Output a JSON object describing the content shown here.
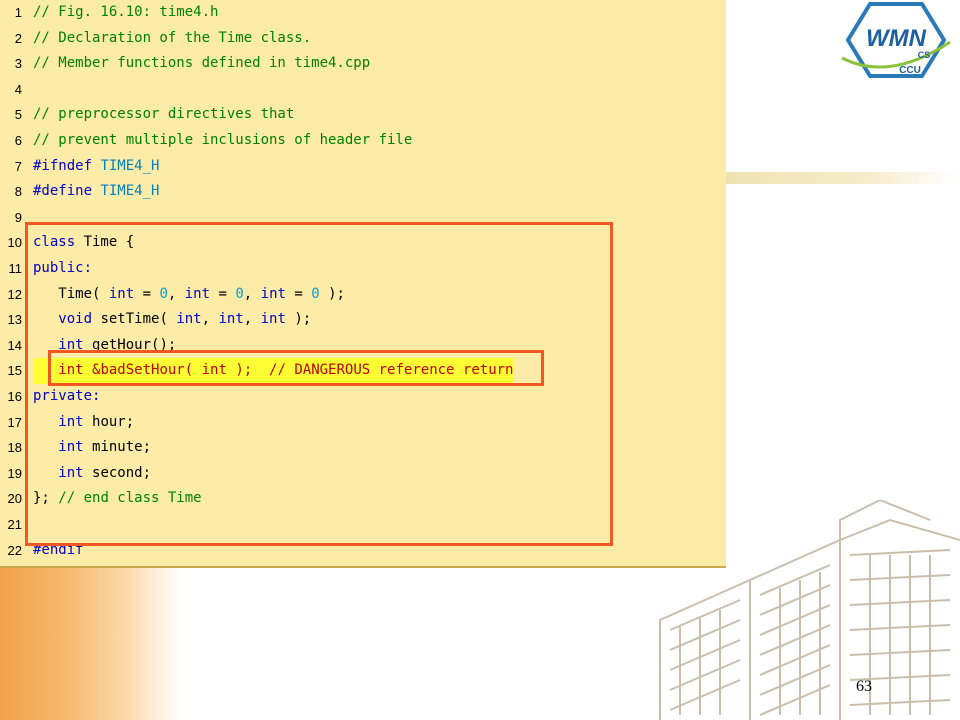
{
  "slide": {
    "page_number": "63",
    "logo": {
      "text_main": "WMN",
      "text_sub": "CS",
      "text_bottom": "CCU"
    }
  },
  "code": {
    "lines": [
      {
        "n": "1",
        "tokens": [
          {
            "t": "// Fig. 16.10: time4.h",
            "c": "cm"
          }
        ]
      },
      {
        "n": "2",
        "tokens": [
          {
            "t": "// Declaration of the Time class.",
            "c": "cm"
          }
        ]
      },
      {
        "n": "3",
        "tokens": [
          {
            "t": "// Member functions defined in time4.cpp",
            "c": "cm"
          }
        ]
      },
      {
        "n": "4",
        "tokens": []
      },
      {
        "n": "5",
        "tokens": [
          {
            "t": "// preprocessor directives that",
            "c": "cm"
          }
        ]
      },
      {
        "n": "6",
        "tokens": [
          {
            "t": "// prevent multiple inclusions of header file",
            "c": "cm"
          }
        ]
      },
      {
        "n": "7",
        "tokens": [
          {
            "t": "#ifndef ",
            "c": "pp"
          },
          {
            "t": "TIME4_H",
            "c": "nm"
          }
        ]
      },
      {
        "n": "8",
        "tokens": [
          {
            "t": "#define ",
            "c": "pp"
          },
          {
            "t": "TIME4_H",
            "c": "nm"
          }
        ]
      },
      {
        "n": "9",
        "tokens": []
      },
      {
        "n": "10",
        "tokens": [
          {
            "t": "class ",
            "c": "kw"
          },
          {
            "t": "Time {",
            "c": "id"
          }
        ]
      },
      {
        "n": "11",
        "tokens": [
          {
            "t": "public:",
            "c": "kw"
          }
        ]
      },
      {
        "n": "12",
        "tokens": [
          {
            "t": "   Time( ",
            "c": "id"
          },
          {
            "t": "int",
            "c": "kw"
          },
          {
            "t": " = ",
            "c": "id"
          },
          {
            "t": "0",
            "c": "num"
          },
          {
            "t": ", ",
            "c": "id"
          },
          {
            "t": "int",
            "c": "kw"
          },
          {
            "t": " = ",
            "c": "id"
          },
          {
            "t": "0",
            "c": "num"
          },
          {
            "t": ", ",
            "c": "id"
          },
          {
            "t": "int",
            "c": "kw"
          },
          {
            "t": " = ",
            "c": "id"
          },
          {
            "t": "0",
            "c": "num"
          },
          {
            "t": " );",
            "c": "id"
          }
        ]
      },
      {
        "n": "13",
        "tokens": [
          {
            "t": "   ",
            "c": "id"
          },
          {
            "t": "void",
            "c": "kw"
          },
          {
            "t": " setTime( ",
            "c": "id"
          },
          {
            "t": "int",
            "c": "kw"
          },
          {
            "t": ", ",
            "c": "id"
          },
          {
            "t": "int",
            "c": "kw"
          },
          {
            "t": ", ",
            "c": "id"
          },
          {
            "t": "int",
            "c": "kw"
          },
          {
            "t": " );",
            "c": "id"
          }
        ]
      },
      {
        "n": "14",
        "tokens": [
          {
            "t": "   ",
            "c": "id"
          },
          {
            "t": "int",
            "c": "kw"
          },
          {
            "t": " getHour();",
            "c": "id"
          }
        ]
      },
      {
        "n": "15",
        "highlight": true,
        "tokens": [
          {
            "t": "   ",
            "c": "id"
          },
          {
            "t": "int",
            "c": "hl-kw"
          },
          {
            "t": " &badSetHour( ",
            "c": "hl-id"
          },
          {
            "t": "int",
            "c": "hl-kw"
          },
          {
            "t": " );  // DANGEROUS reference return",
            "c": "hl-id"
          }
        ]
      },
      {
        "n": "16",
        "tokens": [
          {
            "t": "private:",
            "c": "kw"
          }
        ]
      },
      {
        "n": "17",
        "tokens": [
          {
            "t": "   ",
            "c": "id"
          },
          {
            "t": "int",
            "c": "kw"
          },
          {
            "t": " hour;",
            "c": "id"
          }
        ]
      },
      {
        "n": "18",
        "tokens": [
          {
            "t": "   ",
            "c": "id"
          },
          {
            "t": "int",
            "c": "kw"
          },
          {
            "t": " minute;",
            "c": "id"
          }
        ]
      },
      {
        "n": "19",
        "tokens": [
          {
            "t": "   ",
            "c": "id"
          },
          {
            "t": "int",
            "c": "kw"
          },
          {
            "t": " second;",
            "c": "id"
          }
        ]
      },
      {
        "n": "20",
        "tokens": [
          {
            "t": "}; ",
            "c": "id"
          },
          {
            "t": "// end class Time",
            "c": "cm"
          }
        ]
      },
      {
        "n": "21",
        "tokens": []
      },
      {
        "n": "22",
        "tokens": [
          {
            "t": "#endif",
            "c": "pp"
          }
        ]
      }
    ]
  },
  "colors": {
    "panel_bg": "#fdeba8",
    "highlight_border": "#f05a22",
    "highlight_fill": "#ffff33",
    "comment": "#008000",
    "keyword": "#0000c8"
  }
}
